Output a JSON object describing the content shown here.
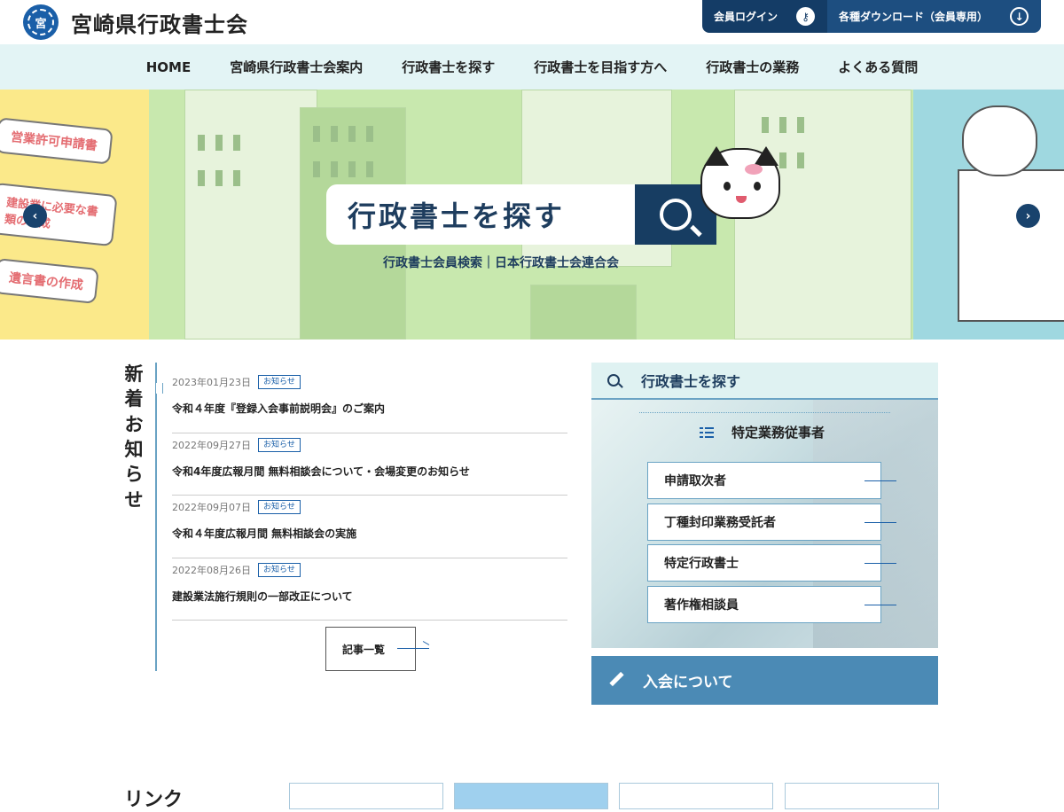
{
  "header": {
    "logo_text": "宮",
    "site_title": "宮崎県行政書士会",
    "login_label": "会員ログイン",
    "download_label": "各種ダウンロード（会員専用）",
    "login_icon": "key-icon",
    "download_icon": "cloud-download-icon"
  },
  "nav": {
    "items": [
      {
        "label": "HOME"
      },
      {
        "label": "宮崎県行政書士会案内"
      },
      {
        "label": "行政書士を探す"
      },
      {
        "label": "行政書士を目指す方へ"
      },
      {
        "label": "行政書士の業務"
      },
      {
        "label": "よくある質問"
      }
    ]
  },
  "hero": {
    "bubbles": [
      "営業許可申請書",
      "建設業に必要な書類の作成",
      "遺言書の作成"
    ],
    "banner_title": "行政書士を探す",
    "banner_sub": "行政書士会員検索｜日本行政書士会連合会",
    "prev": "‹",
    "next": "›"
  },
  "news": {
    "title": "新着お知らせ",
    "items": [
      {
        "date": "2023年01月23日",
        "badge": "お知らせ",
        "text": "令和４年度『登録入会事前説明会』のご案内"
      },
      {
        "date": "2022年09月27日",
        "badge": "お知らせ",
        "text": "令和4年度広報月間 無料相談会について・会場変更のお知らせ"
      },
      {
        "date": "2022年09月07日",
        "badge": "お知らせ",
        "text": "令和４年度広報月間 無料相談会の実施"
      },
      {
        "date": "2022年08月26日",
        "badge": "お知らせ",
        "text": "建設業法施行規則の一部改正について"
      }
    ],
    "more_label": "記事一覧"
  },
  "panel": {
    "title": "行政書士を探す",
    "subtitle": "特定業務従事者",
    "buttons": [
      "申請取次者",
      "丁種封印業務受託者",
      "特定行政書士",
      "著作権相談員"
    ]
  },
  "join": {
    "label": "入会について"
  },
  "links": {
    "title": "リンク"
  },
  "colors": {
    "navy": "#143c66",
    "nav_bg": "#e3f4f5",
    "accent": "#1a5fa8",
    "join_bg": "#4b8ab5"
  }
}
